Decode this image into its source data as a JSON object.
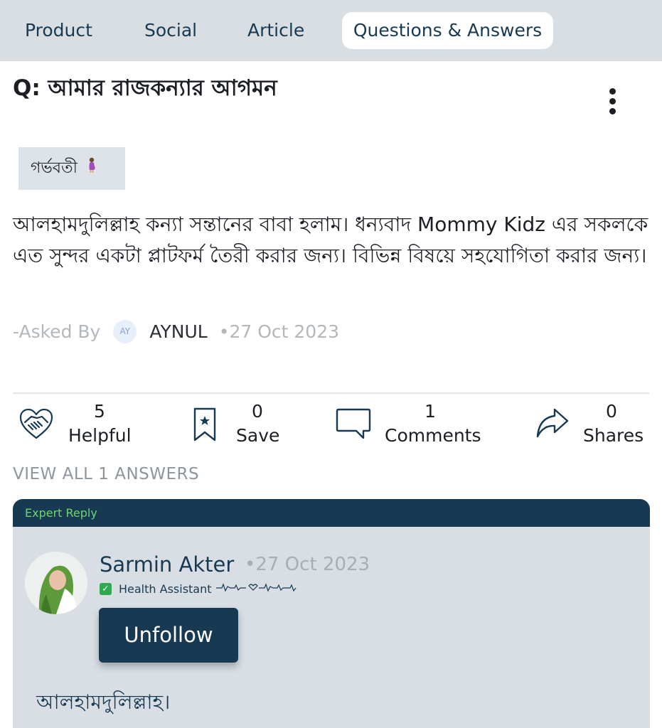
{
  "tabs": [
    {
      "label": "Product"
    },
    {
      "label": "Social"
    },
    {
      "label": "Article"
    },
    {
      "label": "Questions & Answers",
      "active": true
    }
  ],
  "question": {
    "title": "Q: আমার রাজকন্যার আগমন",
    "tag": "গর্ভবতী",
    "tag_icon": "pregnant-woman-icon",
    "body": "আলহামদুলিল্লাহ কন্যা সন্তানের বাবা হলাম। ধন্যবাদ Mommy Kidz এর সকলকে এত সুন্দর একটা প্লাটফর্ম তৈরী করার জন্য। বিভিন্ন বিষয়ে সহযোগিতা করার জন্য।",
    "asked_by_label": "-Asked By",
    "author_initials": "AY",
    "author": "AYNUL",
    "date": "•27 Oct 2023"
  },
  "stats": {
    "helpful": {
      "count": "5",
      "label": "Helpful",
      "icon": "handshake-heart-icon"
    },
    "save": {
      "count": "0",
      "label": "Save",
      "icon": "bookmark-star-icon"
    },
    "comments": {
      "count": "1",
      "label": "Comments",
      "icon": "comment-icon"
    },
    "shares": {
      "count": "0",
      "label": "Shares",
      "icon": "share-arrow-icon"
    }
  },
  "view_all": "VIEW ALL 1 ANSWERS",
  "reply": {
    "header": "Expert Reply",
    "name": "Sarmin Akter",
    "date": "•27 Oct 2023",
    "role": "Health Assistant",
    "follow_button": "Unfollow",
    "answer": "আলহামদুলিল্লাহ।"
  },
  "colors": {
    "primary": "#173a52",
    "tabbar_bg": "#d9dee3",
    "card_bg": "#d8dee3",
    "expert_green": "#6fd46f"
  }
}
